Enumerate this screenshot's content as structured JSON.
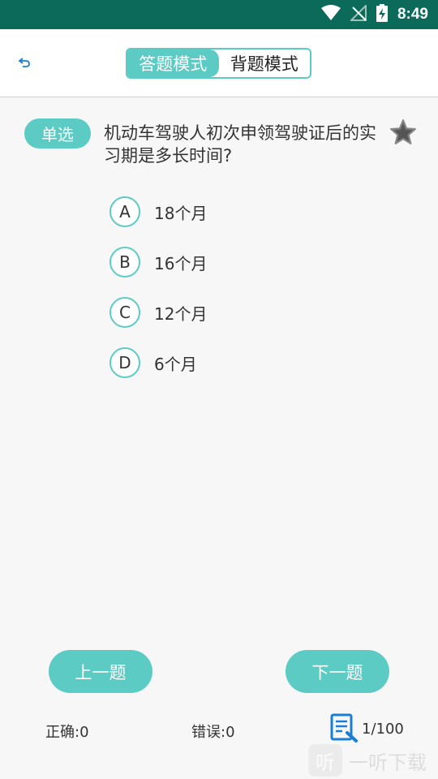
{
  "status_bar": {
    "time": "8:49"
  },
  "header": {
    "modes": [
      "答题模式",
      "背题模式"
    ]
  },
  "question": {
    "type": "单选",
    "text": "机动车驾驶人初次申领驾驶证后的实习期是多长时间?",
    "options": [
      {
        "letter": "A",
        "text": "18个月"
      },
      {
        "letter": "B",
        "text": "16个月"
      },
      {
        "letter": "C",
        "text": "12个月"
      },
      {
        "letter": "D",
        "text": "6个月"
      }
    ]
  },
  "navigation": {
    "prev": "上一题",
    "next": "下一题"
  },
  "footer": {
    "correct": "正确:0",
    "wrong": "错误:0",
    "progress": "1/100"
  },
  "watermark": {
    "logo": "听",
    "text": "一听下载"
  },
  "colors": {
    "accent": "#5ccbc4",
    "status_bar": "#0b6a5a"
  }
}
